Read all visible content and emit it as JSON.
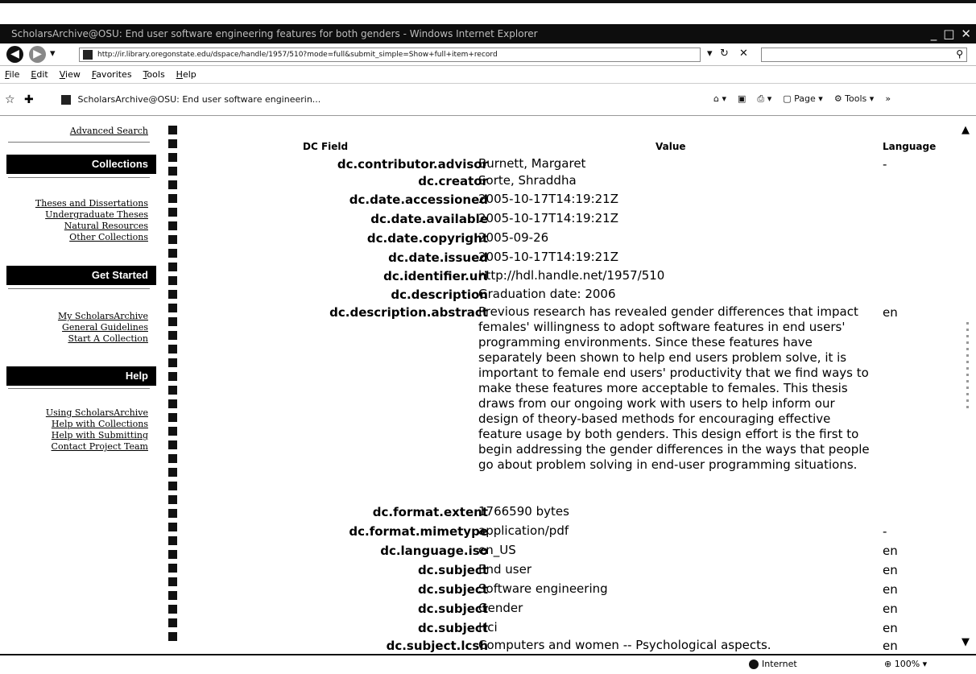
{
  "window": {
    "title": "ScholarsArchive@OSU: End user software engineering features for both genders - Windows Internet Explorer",
    "address": "http://ir.library.oregonstate.edu/dspace/handle/1957/510?mode=full&submit_simple=Show+full+item+record",
    "tab_title": "ScholarsArchive@OSU: End user software engineerin...",
    "zone": "Internet",
    "zoom": "100%"
  },
  "menu": [
    "File",
    "Edit",
    "View",
    "Favorites",
    "Tools",
    "Help"
  ],
  "toolbar": {
    "page_label": "Page",
    "tools_label": "Tools"
  },
  "sidebar": {
    "advanced_search": "Advanced Search",
    "collections_header": "Collections",
    "collections": [
      "Theses and Dissertations",
      "Undergraduate Theses",
      "Natural Resources",
      "Other Collections"
    ],
    "get_started_header": "Get Started",
    "get_started": [
      "My ScholarsArchive",
      "General Guidelines",
      "Start A Collection"
    ],
    "help_header": "Help",
    "help": [
      "Using ScholarsArchive",
      "Help with Collections",
      "Help with Submitting",
      "Contact Project Team"
    ]
  },
  "table": {
    "headers": {
      "field": "DC Field",
      "value": "Value",
      "language": "Language"
    },
    "rows": [
      {
        "field": "dc.contributor.advisor",
        "value": "Burnett, Margaret",
        "language": "-"
      },
      {
        "field": "dc.creator",
        "value": "Sorte, Shraddha",
        "language": ""
      },
      {
        "field": "dc.date.accessioned",
        "value": "2005-10-17T14:19:21Z",
        "language": ""
      },
      {
        "field": "dc.date.available",
        "value": "2005-10-17T14:19:21Z",
        "language": ""
      },
      {
        "field": "dc.date.copyright",
        "value": "2005-09-26",
        "language": ""
      },
      {
        "field": "dc.date.issued",
        "value": "2005-10-17T14:19:21Z",
        "language": ""
      },
      {
        "field": "dc.identifier.uri",
        "value": "http://hdl.handle.net/1957/510",
        "language": ""
      },
      {
        "field": "dc.description",
        "value": "Graduation date: 2006",
        "language": ""
      },
      {
        "field": "dc.description.abstract",
        "value": "Previous research has revealed gender differences that impact females' willingness to adopt software features in end users' programming environments. Since these features have separately been shown to help end users problem solve, it is important to female end users' productivity that we find ways to make these features more acceptable to females. This thesis draws from our ongoing work with users to help inform our design of theory-based methods for encouraging effective feature usage by both genders. This design effort is the first to begin addressing the gender differences in the ways that people go about problem solving in end-user programming situations.",
        "language": "en"
      },
      {
        "field": "dc.format.extent",
        "value": "1766590 bytes",
        "language": ""
      },
      {
        "field": "dc.format.mimetype",
        "value": "application/pdf",
        "language": "-"
      },
      {
        "field": "dc.language.iso",
        "value": "en_US",
        "language": "en"
      },
      {
        "field": "dc.subject",
        "value": "End user",
        "language": "en"
      },
      {
        "field": "dc.subject",
        "value": "Software engineering",
        "language": "en"
      },
      {
        "field": "dc.subject",
        "value": "Gender",
        "language": "en"
      },
      {
        "field": "dc.subject",
        "value": "Hci",
        "language": "en"
      },
      {
        "field": "dc.subject.lcsh",
        "value": "Computers and women -- Psychological aspects.",
        "language": "en"
      }
    ]
  }
}
